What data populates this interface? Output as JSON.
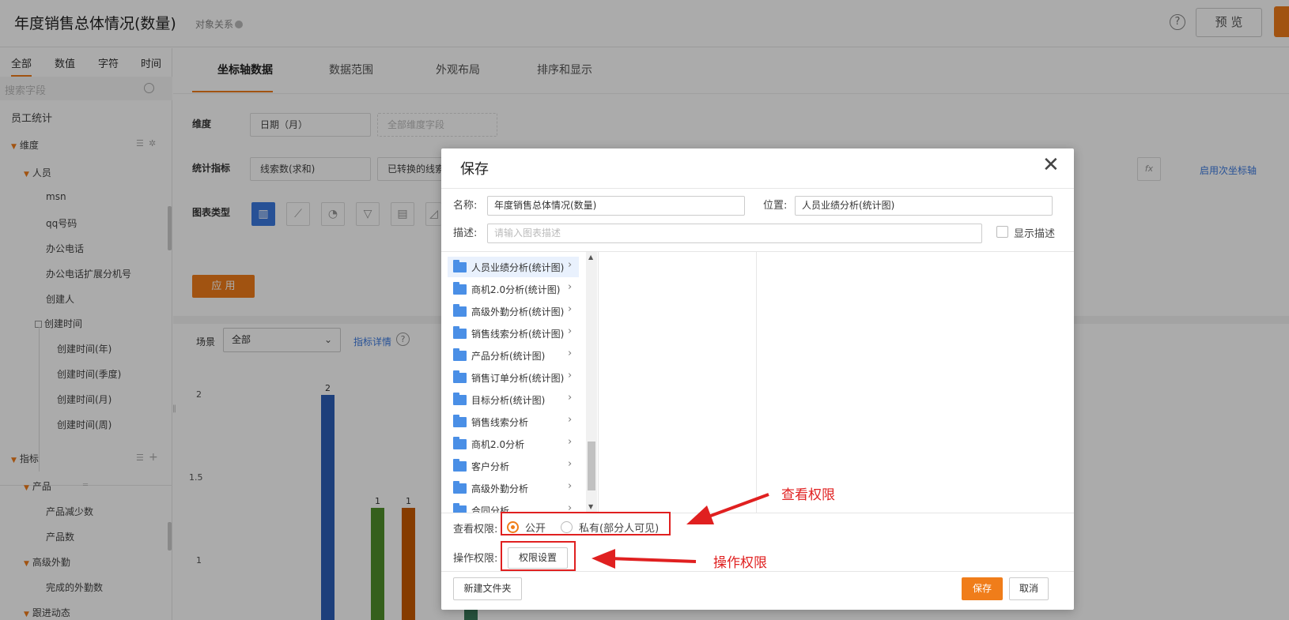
{
  "header": {
    "title": "年度销售总体情况(数量)",
    "object_relation": "对象关系",
    "help": "?",
    "preview": "预 览"
  },
  "sidebar": {
    "tabs": [
      "全部",
      "数值",
      "字符",
      "时间"
    ],
    "search_placeholder": "搜索字段",
    "group_title": "员工统计",
    "dimension": "维度",
    "person": "人员",
    "fields": [
      "msn",
      "qq号码",
      "办公电话",
      "办公电话扩展分机号",
      "创建人"
    ],
    "created_time": "创建时间",
    "created_time_children": [
      "创建时间(年)",
      "创建时间(季度)",
      "创建时间(月)",
      "创建时间(周)"
    ],
    "metric": "指标",
    "product": "产品",
    "product_fields": [
      "产品减少数",
      "产品数"
    ],
    "field_sales": "高级外勤",
    "field_sales_children": [
      "完成的外勤数"
    ],
    "followup": "跟进动态"
  },
  "main": {
    "tabs": [
      "坐标轴数据",
      "数据范围",
      "外观布局",
      "排序和显示"
    ],
    "dimension_label": "维度",
    "dimension_value": "日期（月）",
    "dimension_placeholder": "全部维度字段",
    "metric_label": "统计指标",
    "metric_1": "线索数(求和)",
    "metric_2": "已转换的线索",
    "fx": "fx",
    "secondary_axis": "启用次坐标轴",
    "chart_type_label": "图表类型",
    "apply": "应 用",
    "scene_label": "场景",
    "scene_value": "全部",
    "metric_detail": "指标详情",
    "detail_help": "?"
  },
  "chart_data": {
    "type": "bar",
    "yticks": [
      "2",
      "1.5",
      "1"
    ],
    "ylim": [
      0,
      2
    ],
    "bars": [
      {
        "value": 2,
        "label": "2",
        "color": "#2c5fb8"
      },
      {
        "value": 1,
        "label": "1",
        "color": "#4f8f2a"
      },
      {
        "value": 1,
        "label": "1",
        "color": "#c85a00"
      },
      {
        "value": 0.25,
        "label": "",
        "color": "#3a7a5a"
      }
    ]
  },
  "dialog": {
    "title": "保存",
    "name_label": "名称:",
    "name_value": "年度销售总体情况(数量)",
    "location_label": "位置:",
    "location_value": "人员业绩分析(统计图)",
    "desc_label": "描述:",
    "desc_placeholder": "请输入图表描述",
    "show_desc": "显示描述",
    "folders": [
      "人员业绩分析(统计图)",
      "商机2.0分析(统计图)",
      "高级外勤分析(统计图)",
      "销售线索分析(统计图)",
      "产品分析(统计图)",
      "销售订单分析(统计图)",
      "目标分析(统计图)",
      "销售线索分析",
      "商机2.0分析",
      "客户分析",
      "高级外勤分析",
      "合同分析"
    ],
    "view_perm_label": "查看权限:",
    "public": "公开",
    "private": "私有(部分人可见)",
    "op_perm_label": "操作权限:",
    "perm_settings": "权限设置",
    "new_folder": "新建文件夹",
    "save": "保存",
    "cancel": "取消"
  },
  "annotations": {
    "view_perm": "查看权限",
    "op_perm": "操作权限",
    "color": "#e02020"
  }
}
